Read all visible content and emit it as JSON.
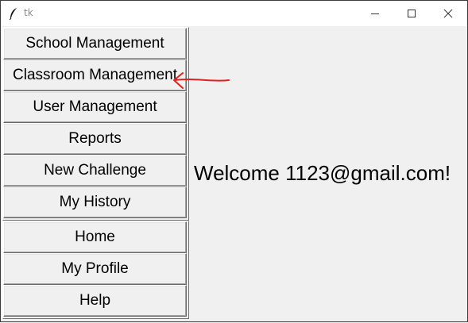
{
  "window": {
    "title": "tk"
  },
  "menu": {
    "main_items": [
      "School Management",
      "Classroom Management",
      "User Management",
      "Reports",
      "New Challenge",
      "My History"
    ],
    "secondary_items": [
      "Home",
      "My Profile",
      "Help"
    ]
  },
  "main": {
    "welcome_text": "Welcome 1123@gmail.com!"
  },
  "colors": {
    "annotation": "#e0201f",
    "background": "#f0f0f0"
  }
}
